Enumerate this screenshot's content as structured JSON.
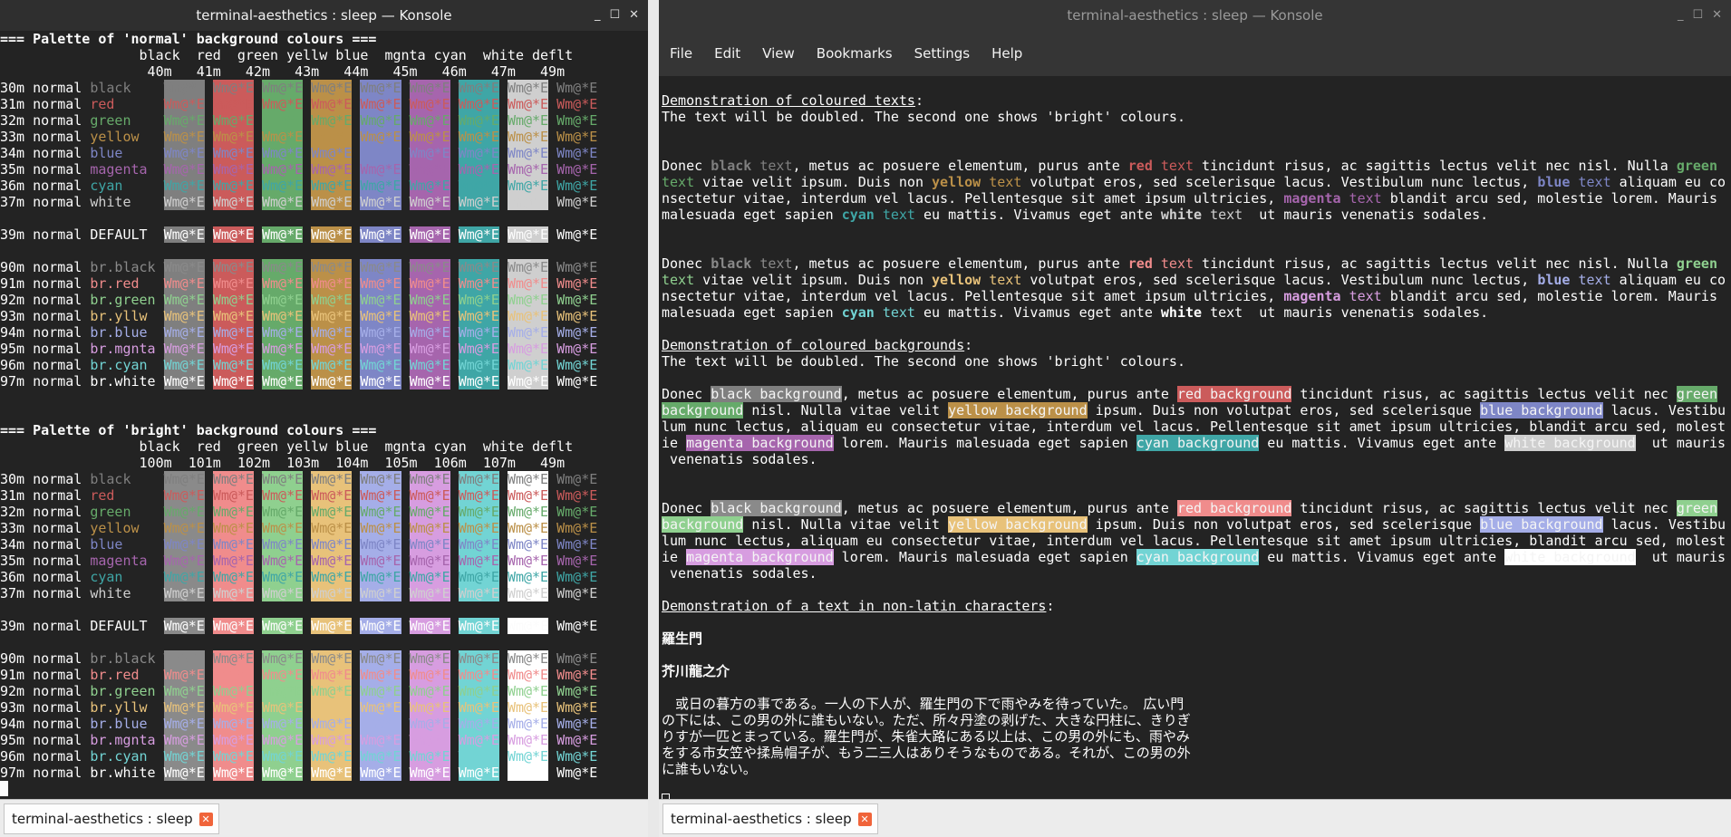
{
  "left_window": {
    "title": "terminal-aesthetics : sleep — Konsole",
    "tab_label": "terminal-aesthetics : sleep",
    "buttons": {
      "minimize": "_",
      "maximize": "☐",
      "close": "✕"
    }
  },
  "right_window": {
    "title": "terminal-aesthetics : sleep — Konsole",
    "tab_label": "terminal-aesthetics : sleep",
    "buttons": {
      "minimize": "_",
      "maximize": "☐",
      "close": "✕"
    },
    "menu": [
      "File",
      "Edit",
      "View",
      "Bookmarks",
      "Settings",
      "Help"
    ]
  },
  "tab_close_glyph": "✕",
  "colors": {
    "normal": {
      "black": "#7f7f7f",
      "red": "#cb5b5b",
      "green": "#66aa6a",
      "yellow": "#bb9048",
      "blue": "#7e86c6",
      "magenta": "#a665ad",
      "cyan": "#3fa6a6",
      "white": "#cfcfcf",
      "default": "#fcfcfc"
    },
    "bright": {
      "black": "#8a8a8a",
      "red": "#f08c8c",
      "green": "#8fd08f",
      "yellow": "#e8c27a",
      "blue": "#a5aee8",
      "magenta": "#d79de0",
      "cyan": "#72d4d4",
      "white": "#ffffff",
      "default": "#fcfcfc"
    },
    "background": "#232323"
  },
  "left_lines": [
    "=== Palette of 'normal' background colours ===",
    "                 black  red  green yellw blue  mgnta cyan  white deflt",
    "                  40m   41m   42m   43m   44m   45m   46m   47m   49m",
    "30m normal black    Wm@*E Wm@*E Wm@*E Wm@*E Wm@*E Wm@*E Wm@*E Wm@*E Wm@*E",
    "31m normal red      Wm@*E Wm@*E Wm@*E Wm@*E Wm@*E Wm@*E Wm@*E Wm@*E Wm@*E",
    "32m normal green    Wm@*E Wm@*E Wm@*E Wm@*E Wm@*E Wm@*E Wm@*E Wm@*E Wm@*E",
    "33m normal yellow   Wm@*E Wm@*E Wm@*E Wm@*E Wm@*E Wm@*E Wm@*E Wm@*E Wm@*E",
    "34m normal blue     Wm@*E Wm@*E Wm@*E Wm@*E Wm@*E Wm@*E Wm@*E Wm@*E Wm@*E",
    "35m normal magenta  Wm@*E Wm@*E Wm@*E Wm@*E Wm@*E Wm@*E Wm@*E Wm@*E Wm@*E",
    "36m normal cyan     Wm@*E Wm@*E Wm@*E Wm@*E Wm@*E Wm@*E Wm@*E Wm@*E Wm@*E",
    "37m normal white    Wm@*E Wm@*E Wm@*E Wm@*E Wm@*E Wm@*E Wm@*E Wm@*E Wm@*E",
    "",
    "39m normal DEFAULT  Wm@*E Wm@*E Wm@*E Wm@*E Wm@*E Wm@*E Wm@*E Wm@*E Wm@*E",
    "",
    "90m normal br.black Wm@*E Wm@*E Wm@*E Wm@*E Wm@*E Wm@*E Wm@*E Wm@*E Wm@*E",
    "91m normal br.red   Wm@*E Wm@*E Wm@*E Wm@*E Wm@*E Wm@*E Wm@*E Wm@*E Wm@*E",
    "92m normal br.green Wm@*E Wm@*E Wm@*E Wm@*E Wm@*E Wm@*E Wm@*E Wm@*E Wm@*E",
    "93m normal br.yllw  Wm@*E Wm@*E Wm@*E Wm@*E Wm@*E Wm@*E Wm@*E Wm@*E Wm@*E",
    "94m normal br.blue  Wm@*E Wm@*E Wm@*E Wm@*E Wm@*E Wm@*E Wm@*E Wm@*E Wm@*E",
    "95m normal br.mgnta Wm@*E Wm@*E Wm@*E Wm@*E Wm@*E Wm@*E Wm@*E Wm@*E Wm@*E",
    "96m normal br.cyan  Wm@*E Wm@*E Wm@*E Wm@*E Wm@*E Wm@*E Wm@*E Wm@*E Wm@*E",
    "97m normal br.white Wm@*E Wm@*E Wm@*E Wm@*E Wm@*E Wm@*E Wm@*E Wm@*E Wm@*E",
    "",
    "",
    "=== Palette of 'bright' background colours ===",
    "                 black  red  green yellw blue  mgnta cyan  white deflt",
    "                 100m  101m  102m  103m  104m  105m  106m  107m   49m",
    "30m normal black    Wm@*E Wm@*E Wm@*E Wm@*E Wm@*E Wm@*E Wm@*E Wm@*E Wm@*E",
    "31m normal red      Wm@*E Wm@*E Wm@*E Wm@*E Wm@*E Wm@*E Wm@*E Wm@*E Wm@*E",
    "32m normal green    Wm@*E Wm@*E Wm@*E Wm@*E Wm@*E Wm@*E Wm@*E Wm@*E Wm@*E",
    "33m normal yellow   Wm@*E Wm@*E Wm@*E Wm@*E Wm@*E Wm@*E Wm@*E Wm@*E Wm@*E",
    "34m normal blue     Wm@*E Wm@*E Wm@*E Wm@*E Wm@*E Wm@*E Wm@*E Wm@*E Wm@*E",
    "35m normal magenta  Wm@*E Wm@*E Wm@*E Wm@*E Wm@*E Wm@*E Wm@*E Wm@*E Wm@*E",
    "36m normal cyan     Wm@*E Wm@*E Wm@*E Wm@*E Wm@*E Wm@*E Wm@*E Wm@*E Wm@*E",
    "37m normal white    Wm@*E Wm@*E Wm@*E Wm@*E Wm@*E Wm@*E Wm@*E Wm@*E Wm@*E",
    "",
    "39m normal DEFAULT  Wm@*E Wm@*E Wm@*E Wm@*E Wm@*E Wm@*E Wm@*E Wm@*E Wm@*E",
    "",
    "90m normal br.black Wm@*E Wm@*E Wm@*E Wm@*E Wm@*E Wm@*E Wm@*E Wm@*E Wm@*E",
    "91m normal br.red   Wm@*E Wm@*E Wm@*E Wm@*E Wm@*E Wm@*E Wm@*E Wm@*E Wm@*E",
    "92m normal br.green Wm@*E Wm@*E Wm@*E Wm@*E Wm@*E Wm@*E Wm@*E Wm@*E Wm@*E",
    "93m normal br.yllw  Wm@*E Wm@*E Wm@*E Wm@*E Wm@*E Wm@*E Wm@*E Wm@*E Wm@*E",
    "94m normal br.blue  Wm@*E Wm@*E Wm@*E Wm@*E Wm@*E Wm@*E Wm@*E Wm@*E Wm@*E",
    "95m normal br.mgnta Wm@*E Wm@*E Wm@*E Wm@*E Wm@*E Wm@*E Wm@*E Wm@*E Wm@*E",
    "96m normal br.cyan  Wm@*E Wm@*E Wm@*E Wm@*E Wm@*E Wm@*E Wm@*E Wm@*E Wm@*E",
    "97m normal br.white Wm@*E Wm@*E Wm@*E Wm@*E Wm@*E Wm@*E Wm@*E Wm@*E Wm@*E"
  ],
  "right_lines": [
    "",
    "Demonstration of coloured texts:",
    "The text will be doubled. The second one shows 'bright' colours.",
    "",
    "",
    "Donec black text, metus ac posuere elementum, purus ante red text tincidunt risus, ac sagittis lectus velit nec nisl. Nulla green",
    "text vitae velit ipsum. Duis non yellow text volutpat eros, sed scelerisque lacus. Vestibulum nunc lectus, blue text aliquam eu co",
    "nsectetur vitae, interdum vel lacus. Pellentesque sit amet ipsum ultricies, magenta text blandit arcu sed, molestie lorem. Mauris",
    "malesuada eget sapien cyan text eu mattis. Vivamus eget ante white text  ut mauris venenatis sodales.",
    "",
    "",
    "Donec black text, metus ac posuere elementum, purus ante red text tincidunt risus, ac sagittis lectus velit nec nisl. Nulla green",
    "text vitae velit ipsum. Duis non yellow text volutpat eros, sed scelerisque lacus. Vestibulum nunc lectus, blue text aliquam eu co",
    "nsectetur vitae, interdum vel lacus. Pellentesque sit amet ipsum ultricies, magenta text blandit arcu sed, molestie lorem. Mauris",
    "malesuada eget sapien cyan text eu mattis. Vivamus eget ante white text  ut mauris venenatis sodales.",
    "",
    "Demonstration of coloured backgrounds:",
    "The text will be doubled. The second one shows 'bright' colours.",
    "",
    "Donec black background, metus ac posuere elementum, purus ante red background tincidunt risus, ac sagittis lectus velit nec green",
    "background nisl. Nulla vitae velit yellow background ipsum. Duis non volutpat eros, sed scelerisque blue background lacus. Vestibu",
    "lum nunc lectus, aliquam eu consectetur vitae, interdum vel lacus. Pellentesque sit amet ipsum ultricies, blandit arcu sed, molest",
    "ie magenta background lorem. Mauris malesuada eget sapien cyan background eu mattis. Vivamus eget ante white background  ut mauris",
    " venenatis sodales.",
    "",
    "",
    "Donec black background, metus ac posuere elementum, purus ante red background tincidunt risus, ac sagittis lectus velit nec green",
    "background nisl. Nulla vitae velit yellow background ipsum. Duis non volutpat eros, sed scelerisque blue background lacus. Vestibu",
    "lum nunc lectus, aliquam eu consectetur vitae, interdum vel lacus. Pellentesque sit amet ipsum ultricies, blandit arcu sed, molest",
    "ie magenta background lorem. Mauris malesuada eget sapien cyan background eu mattis. Vivamus eget ante white background  ut mauris",
    " venenatis sodales.",
    "",
    "Demonstration of a text in non-latin characters:",
    "",
    "羅生門",
    "",
    "芥川龍之介",
    "",
    "　或日の暮方の事である。一人の下人が、羅生門の下で雨やみを待っていた。　広い門",
    "の下には、この男の外に誰もいない。ただ、所々丹塗の剥げた、大きな円柱に、きりぎ",
    "りすが一匹とまっている。羅生門が、朱雀大路にある以上は、この男の外にも、雨やみ",
    "をする市女笠や揉烏帽子が、もう二三人はありそうなものである。それが、この男の外",
    "に誰もいない。"
  ]
}
